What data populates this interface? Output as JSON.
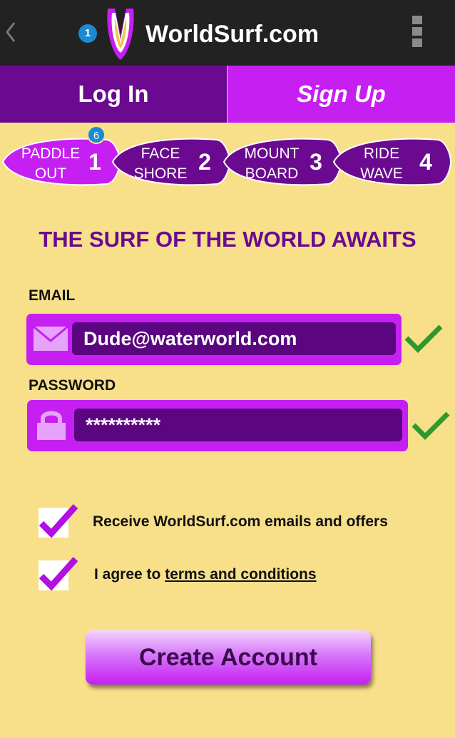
{
  "header": {
    "title": "WorldSurf.com",
    "notification_count": "1",
    "icons": [
      "back-chevron-icon",
      "surf-logo-icon",
      "overflow-menu-icon"
    ]
  },
  "tabs": [
    {
      "label": "Log In",
      "active": false
    },
    {
      "label": "Sign Up",
      "active": true
    }
  ],
  "steps": [
    {
      "line1": "PADDLE",
      "line2": "OUT",
      "number": "1",
      "active": true,
      "badge": "6"
    },
    {
      "line1": "FACE",
      "line2": "SHORE",
      "number": "2",
      "active": false
    },
    {
      "line1": "MOUNT",
      "line2": "BOARD",
      "number": "3",
      "active": false
    },
    {
      "line1": "RIDE",
      "line2": "WAVE",
      "number": "4",
      "active": false
    }
  ],
  "form": {
    "heading": "THE SURF OF THE WORLD AWAITS",
    "email_label": "EMAIL",
    "email_value": "Dude@waterworld.com",
    "password_label": "PASSWORD",
    "password_value": "**********",
    "checkbox_emails": {
      "label": "Receive WorldSurf.com emails and offers",
      "checked": true
    },
    "checkbox_terms": {
      "prefix": "I agree to ",
      "link": "terms and conditions",
      "checked": true
    },
    "submit_label": "Create Account"
  },
  "colors": {
    "background": "#f8e08a",
    "purple_dark": "#6b0a90",
    "purple_bright": "#c61ff2",
    "input_bg": "#5b0680",
    "check_green": "#2e9a2e"
  }
}
